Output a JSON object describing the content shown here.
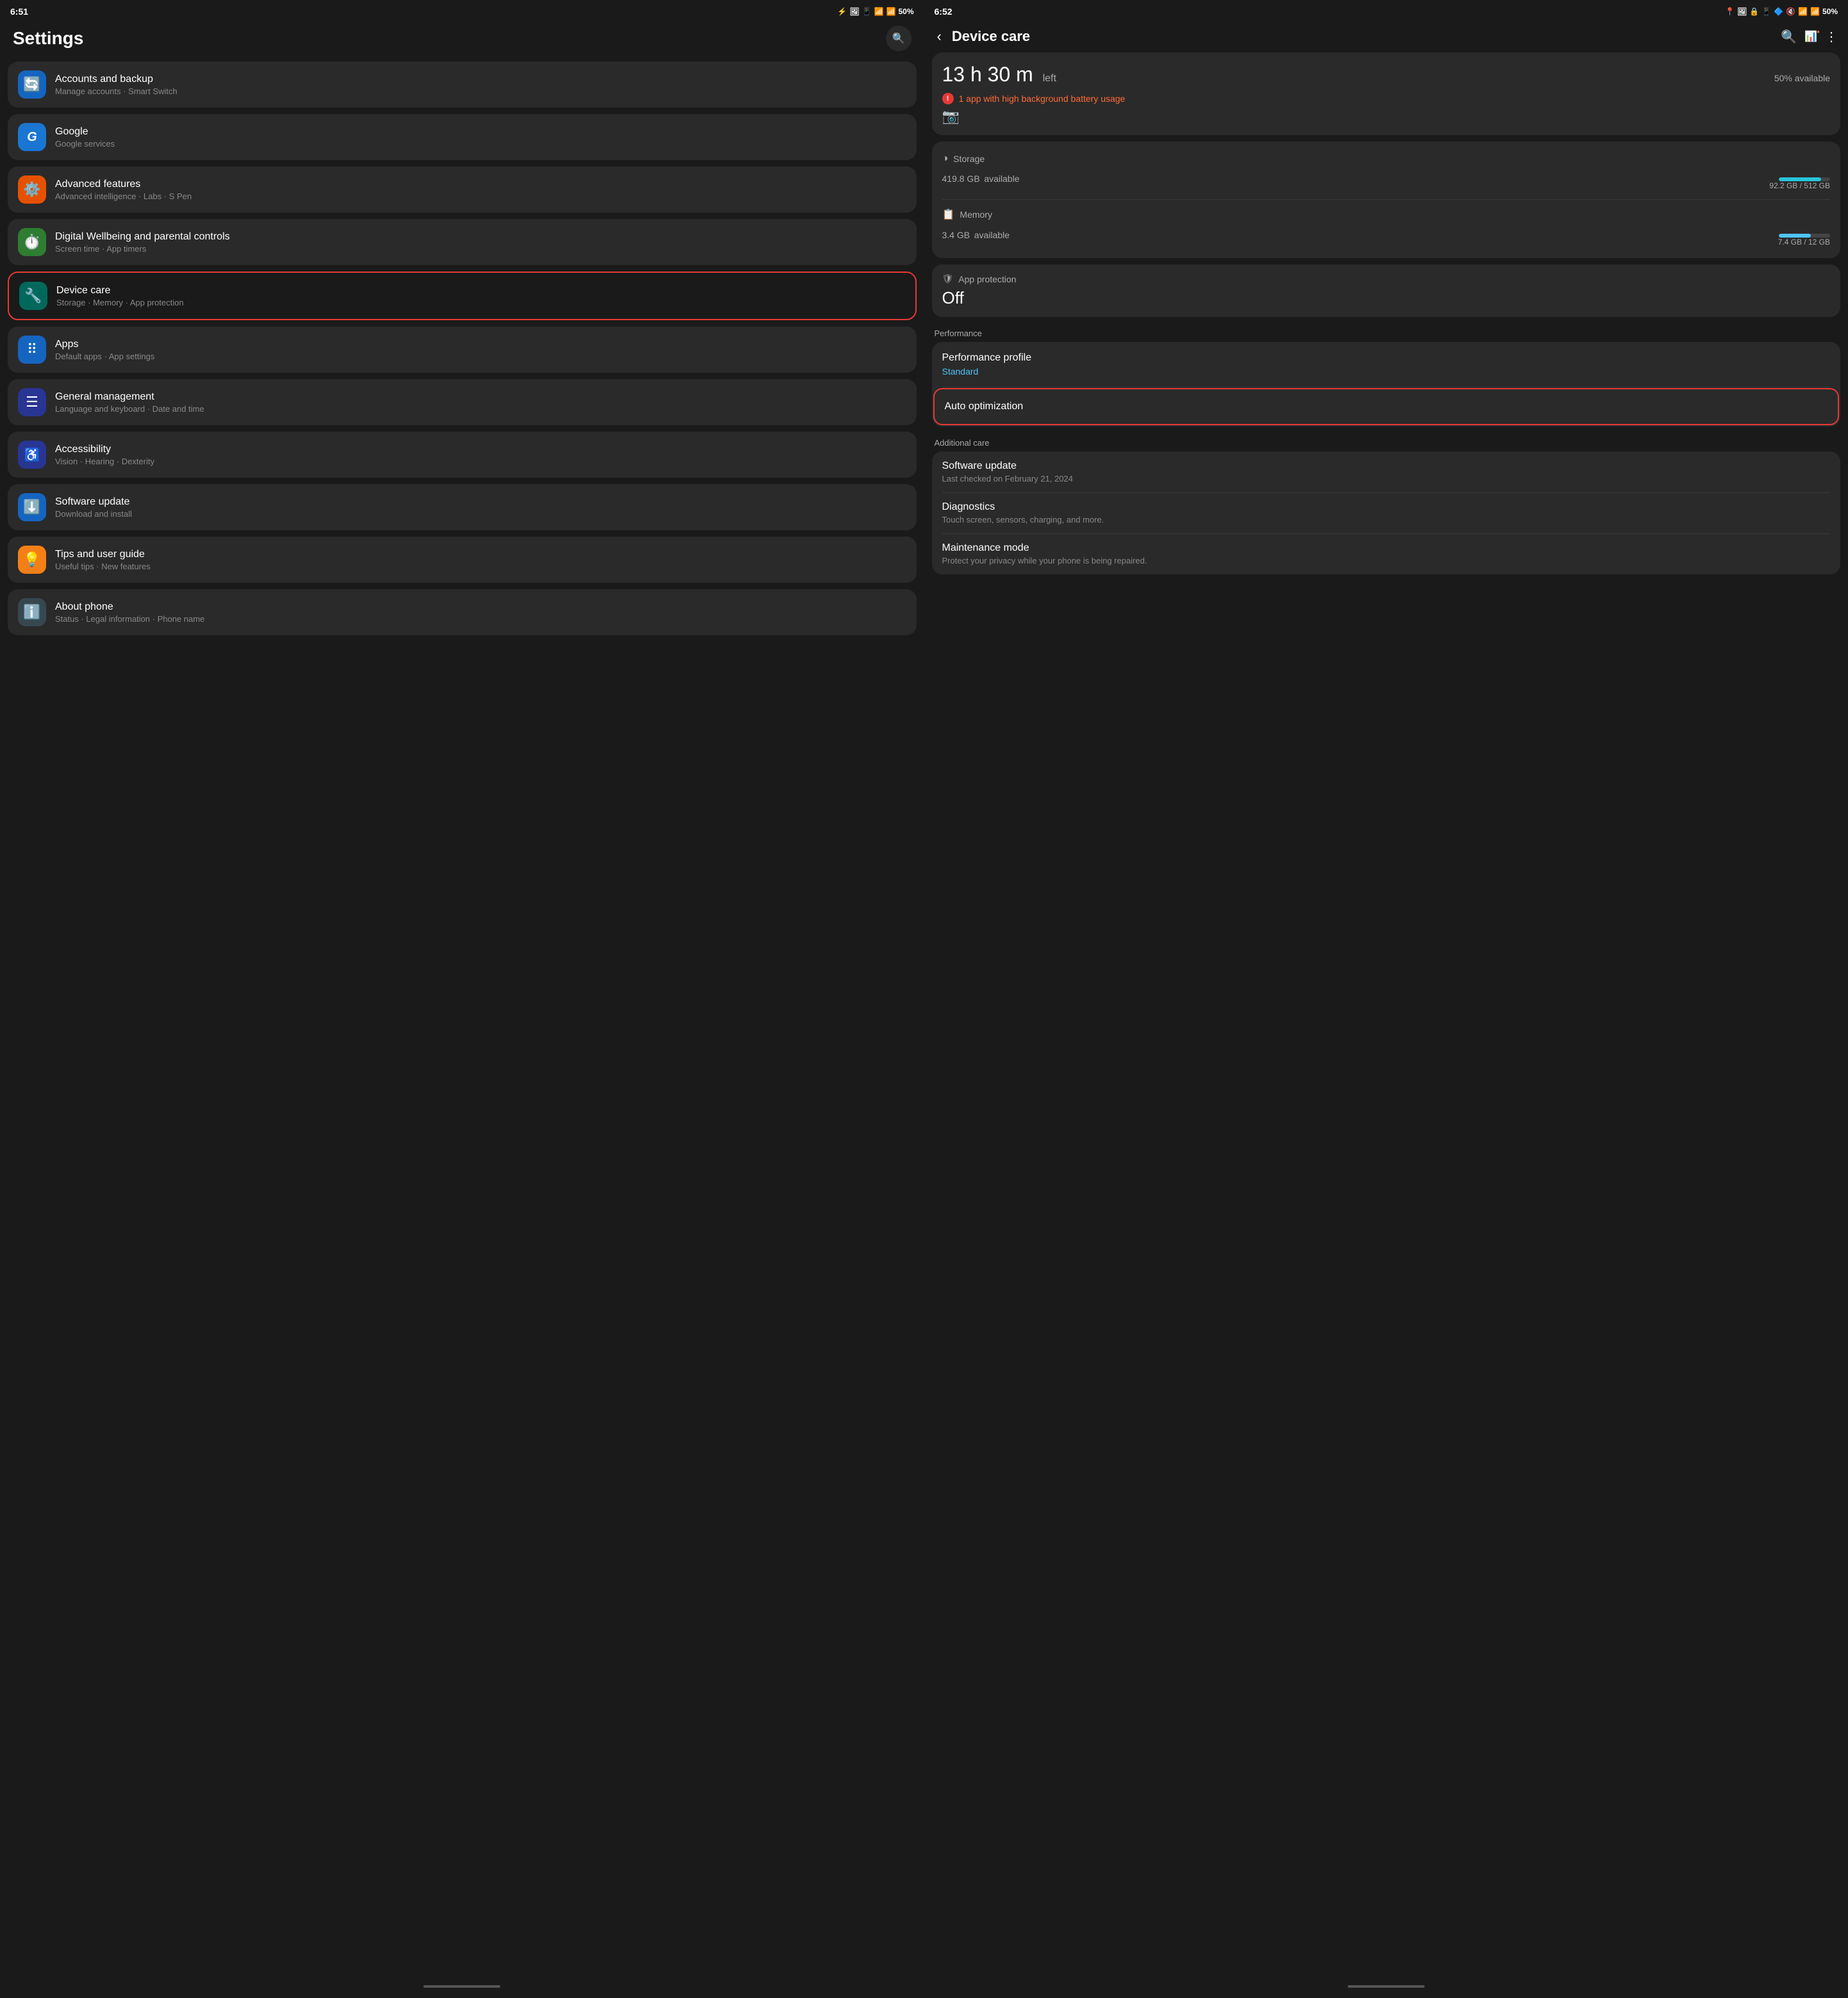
{
  "left_screen": {
    "status": {
      "time": "6:51",
      "battery": "50%"
    },
    "title": "Settings",
    "search_label": "Search",
    "items": [
      {
        "id": "accounts",
        "icon": "🔄",
        "icon_bg": "bg-blue",
        "title": "Accounts and backup",
        "subtitle": "Manage accounts · Smart Switch",
        "highlighted": false
      },
      {
        "id": "google",
        "icon": "G",
        "icon_bg": "bg-blue-light",
        "title": "Google",
        "subtitle": "Google services",
        "highlighted": false
      },
      {
        "id": "advanced",
        "icon": "⚙",
        "icon_bg": "bg-orange",
        "title": "Advanced features",
        "subtitle": "Advanced intelligence · Labs · S Pen",
        "highlighted": false
      },
      {
        "id": "digital-wellbeing",
        "icon": "⏱",
        "icon_bg": "bg-green",
        "title": "Digital Wellbeing and parental controls",
        "subtitle": "Screen time · App timers",
        "highlighted": false
      },
      {
        "id": "device-care",
        "icon": "🔧",
        "icon_bg": "bg-teal",
        "title": "Device care",
        "subtitle": "Storage · Memory · App protection",
        "highlighted": true
      },
      {
        "id": "apps",
        "icon": "⠿",
        "icon_bg": "bg-blue",
        "title": "Apps",
        "subtitle": "Default apps · App settings",
        "highlighted": false
      },
      {
        "id": "general",
        "icon": "≡",
        "icon_bg": "bg-indigo",
        "title": "General management",
        "subtitle": "Language and keyboard · Date and time",
        "highlighted": false
      },
      {
        "id": "accessibility",
        "icon": "♿",
        "icon_bg": "bg-indigo",
        "title": "Accessibility",
        "subtitle": "Vision · Hearing · Dexterity",
        "highlighted": false
      },
      {
        "id": "software-update",
        "icon": "⬇",
        "icon_bg": "bg-blue",
        "title": "Software update",
        "subtitle": "Download and install",
        "highlighted": false
      },
      {
        "id": "tips",
        "icon": "💡",
        "icon_bg": "bg-amber",
        "title": "Tips and user guide",
        "subtitle": "Useful tips · New features",
        "highlighted": false
      },
      {
        "id": "about",
        "icon": "ℹ",
        "icon_bg": "bg-grey",
        "title": "About phone",
        "subtitle": "Status · Legal information · Phone name",
        "highlighted": false
      }
    ]
  },
  "right_screen": {
    "status": {
      "time": "6:52",
      "battery": "50%"
    },
    "title": "Device care",
    "battery": {
      "time_left": "13 h 30 m",
      "time_left_suffix": "left",
      "available_percent": "50% available",
      "warning": "1 app with high background battery usage"
    },
    "storage": {
      "label": "Storage",
      "value": "419.8 GB",
      "value_suffix": "available",
      "progress_label": "92.2 GB / 512 GB",
      "progress_pct": 82
    },
    "memory": {
      "label": "Memory",
      "value": "3.4 GB",
      "value_suffix": "available",
      "progress_label": "7.4 GB / 12 GB",
      "progress_pct": 62
    },
    "app_protection": {
      "label": "App protection",
      "value": "Off"
    },
    "performance": {
      "section_label": "Performance",
      "profile_label": "Performance profile",
      "profile_value": "Standard",
      "auto_opt_label": "Auto optimization",
      "auto_opt_highlighted": true
    },
    "additional_care": {
      "section_label": "Additional care",
      "items": [
        {
          "title": "Software update",
          "subtitle": "Last checked on February 21, 2024"
        },
        {
          "title": "Diagnostics",
          "subtitle": "Touch screen, sensors, charging, and more."
        },
        {
          "title": "Maintenance mode",
          "subtitle": "Protect your privacy while your phone is being repaired."
        }
      ]
    }
  }
}
